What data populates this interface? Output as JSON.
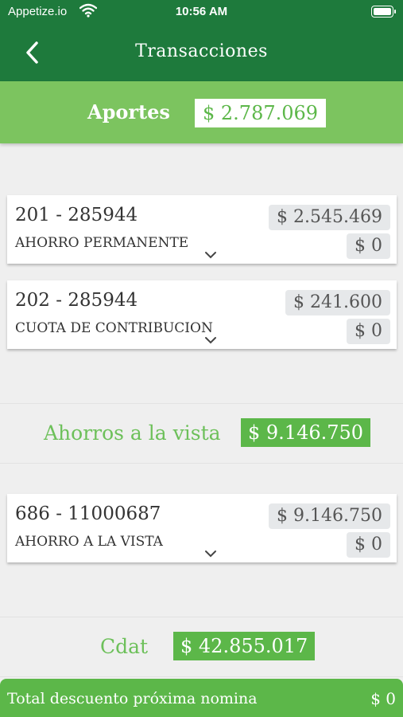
{
  "status_bar": {
    "carrier": "Appetize.io",
    "time": "10:56 AM"
  },
  "nav": {
    "title": "Transacciones"
  },
  "aportes": {
    "label": "Aportes",
    "total": "$ 2.787.069"
  },
  "aportes_items": [
    {
      "code": "201 - 285944",
      "description": "AHORRO PERMANENTE",
      "balance": "$ 2.545.469",
      "discount": "$ 0"
    },
    {
      "code": "202 - 285944",
      "description": "CUOTA DE CONTRIBUCION",
      "balance": "$ 241.600",
      "discount": "$ 0"
    }
  ],
  "ahorros": {
    "label": "Ahorros a la vista",
    "total": "$ 9.146.750"
  },
  "ahorros_items": [
    {
      "code": "686 - 11000687",
      "description": "AHORRO A LA VISTA",
      "balance": "$ 9.146.750",
      "discount": "$ 0"
    }
  ],
  "cdat": {
    "label": "Cdat",
    "total": "$ 42.855.017"
  },
  "footer": {
    "label": "Total descuento próxima nomina",
    "total": "$ 0"
  }
}
